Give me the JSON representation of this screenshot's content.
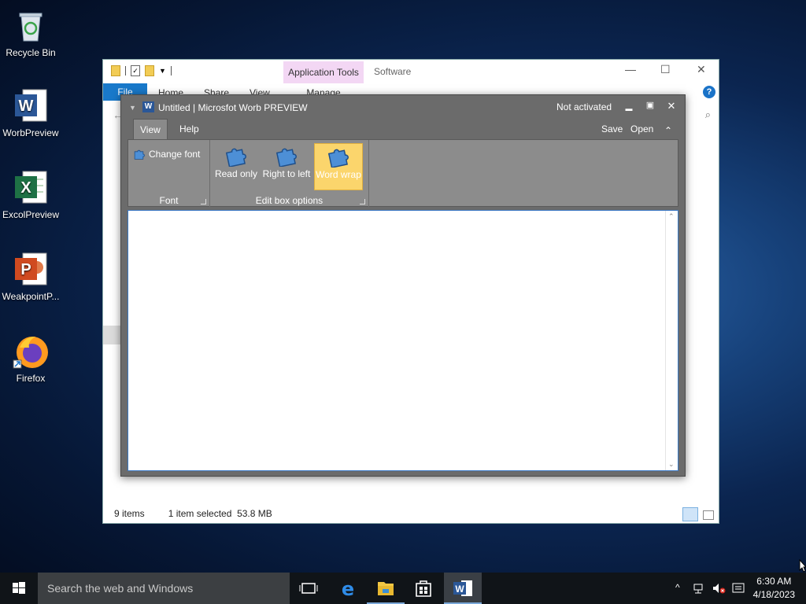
{
  "desktop": {
    "icons": [
      {
        "label": "Recycle Bin",
        "icon": "recycle-bin-icon"
      },
      {
        "label": "WorbPreview",
        "icon": "word-doc-icon"
      },
      {
        "label": "ExcolPreview",
        "icon": "excel-sheet-icon"
      },
      {
        "label": "WeakpointP...",
        "icon": "powerpoint-icon"
      },
      {
        "label": "Firefox",
        "icon": "firefox-icon"
      }
    ]
  },
  "explorer": {
    "context_tab": "Application Tools",
    "title": "Software",
    "tabs": {
      "file": "File",
      "home": "Home",
      "share": "Share",
      "view": "View",
      "manage": "Manage"
    },
    "status": {
      "items": "9 items",
      "selected": "1 item selected",
      "size": "53.8 MB"
    },
    "help": "?"
  },
  "word": {
    "title": "Untitled | Microsfot Worb PREVIEW",
    "activation": "Not activated",
    "logo": "W",
    "tabs": {
      "view": "View",
      "help": "Help"
    },
    "links": {
      "save": "Save",
      "open": "Open"
    },
    "ribbon": {
      "change_font": "Change font",
      "font_group": "Font",
      "read_only": "Read only",
      "right_to_left": "Right to left",
      "word_wrap": "Word wrap",
      "edit_group": "Edit box options"
    },
    "controls": {
      "minimize": "▬",
      "maximize": "▣",
      "close": "✕",
      "collapse": "⌃"
    }
  },
  "taskbar": {
    "search_placeholder": "Search the web and Windows",
    "time": "6:30 AM",
    "date": "4/18/2023"
  },
  "colors": {
    "accent": "#1979ca",
    "word_chrome": "#6b6b6b",
    "ribbon": "#8c8c8c",
    "selected_button": "#fbd56c"
  }
}
